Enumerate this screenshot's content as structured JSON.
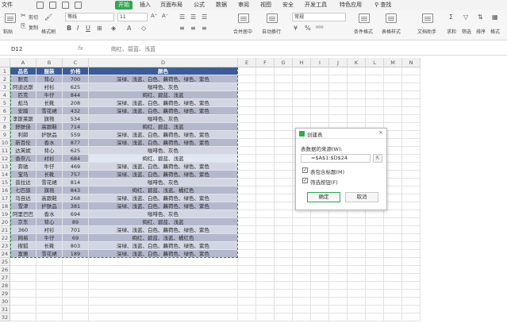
{
  "menu": {
    "items": [
      "文件",
      "开始",
      "插入",
      "页面布局",
      "公式",
      "数据",
      "审阅",
      "视图",
      "安全",
      "开发工具",
      "特色应用"
    ],
    "active_index": 1,
    "search": "查找"
  },
  "ribbon": {
    "paste": "粘贴",
    "cut": "剪切",
    "copy": "复制",
    "format_painter": "格式刷",
    "font_name": "等线",
    "font_size": "11",
    "number_format": "常规",
    "merge_center": "合并居中",
    "wrap_text": "自动换行",
    "conditional_format": "条件格式",
    "table_style": "表格样式",
    "doc_helper": "文档助手",
    "sum": "求和",
    "filter": "筛选",
    "sort": "排序",
    "format": "格式"
  },
  "formula_bar": {
    "name_box": "D12",
    "fx": "fx",
    "content": "绚红、碧蓝、浅蓝"
  },
  "sheet": {
    "columns": [
      "A",
      "B",
      "C",
      "D",
      "E",
      "F",
      "G",
      "H",
      "I",
      "J",
      "K",
      "L",
      "M",
      "N"
    ],
    "row_numbers": [
      "1",
      "2",
      "3",
      "4",
      "5",
      "6",
      "7",
      "8",
      "9",
      "10",
      "11",
      "12",
      "13",
      "14",
      "15",
      "16",
      "17",
      "18",
      "19",
      "20",
      "21",
      "22",
      "23",
      "24",
      "25",
      "26",
      "27",
      "28",
      "29",
      "30",
      "31",
      "32"
    ],
    "header": [
      "品名",
      "服装",
      "价格",
      "颜色"
    ],
    "rows": [
      [
        "耐克",
        "背心",
        "700",
        "深绿、浅蓝、白色、藕荷色、绿色、紫色"
      ],
      [
        "阿迪达斯",
        "衬衫",
        "625",
        "咖啡色、灰色"
      ],
      [
        "匹克",
        "牛仔",
        "844",
        "绚红、碧蓝、浅蓝"
      ],
      [
        "彪马",
        "长靴",
        "208",
        "深绿、浅蓝、白色、藕荷色、绿色、紫色"
      ],
      [
        "安踏",
        "雪花裙",
        "432",
        "深绿、浅蓝、白色、藕荷色、绿色、紫色"
      ],
      [
        "李斯莱斯",
        "旗袍",
        "534",
        "咖啡色、灰色"
      ],
      [
        "舒肤佳",
        "高跟鞋",
        "714",
        "绚红、碧蓝、浅蓝"
      ],
      [
        "利郎",
        "护肤品",
        "559",
        "深绿、浅蓝、白色、藕荷色、绿色、紫色"
      ],
      [
        "新百伦",
        "香水",
        "877",
        "深绿、浅蓝、白色、藕荷色、绿色、紫色"
      ],
      [
        "达芙妮",
        "背心",
        "625",
        "咖啡色、灰色"
      ],
      [
        "香奈儿",
        "衬衫",
        "684",
        "绚红、碧蓝、浅蓝"
      ],
      [
        "奔驰",
        "牛仔",
        "469",
        "深绿、浅蓝、白色、藕荷色、绿色、紫色"
      ],
      [
        "宝马",
        "长靴",
        "757",
        "深绿、浅蓝、白色、藕荷色、绿色、紫色"
      ],
      [
        "普拉达",
        "雪花裙",
        "814",
        "咖啡色、灰色"
      ],
      [
        "七匹狼",
        "旗袍",
        "843",
        "绚红、碧蓝、浅蓝、橘红色"
      ],
      [
        "马自达",
        "高跟鞋",
        "268",
        "深绿、浅蓝、白色、藕荷色、绿色、紫色"
      ],
      [
        "雪津",
        "护肤品",
        "381",
        "深绿、浅蓝、白色、藕荷色、绿色、紫色"
      ],
      [
        "阿里巴巴",
        "香水",
        "694",
        "咖啡色、灰色"
      ],
      [
        "京东",
        "背心",
        "89",
        "绚红、碧蓝、浅蓝"
      ],
      [
        "360",
        "衬衫",
        "701",
        "深绿、浅蓝、白色、藕荷色、绿色、紫色"
      ],
      [
        "网易",
        "牛仔",
        "69",
        "绚红、碧蓝、浅蓝、橘红色"
      ],
      [
        "搜狐",
        "长靴",
        "803",
        "深绿、浅蓝、白色、藕荷色、绿色、紫色"
      ],
      [
        "富雅",
        "雪花裙",
        "189",
        "深绿、浅蓝、白色、藕荷色、绿色、紫色"
      ]
    ]
  },
  "dialog": {
    "title": "创建表",
    "close": "×",
    "source_label": "表数据的来源(W):",
    "range": "=$A$1:$D$24",
    "check_header": "表包含标题(M)",
    "check_filter": "筛选按钮(F)",
    "ok": "确定",
    "cancel": "取消"
  },
  "colors": {
    "accent": "#2fa84f",
    "header_fill": "#3d5a9e",
    "band_dark": "#b3b8cc",
    "band_light": "#d2d6e4"
  }
}
